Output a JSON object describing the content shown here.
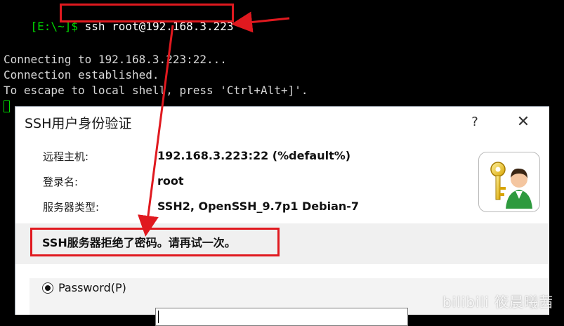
{
  "terminal": {
    "prompt": "[E:\\~]$",
    "command": "ssh root@192.168.3.223",
    "output": [
      "Connecting to 192.168.3.223:22...",
      "Connection established.",
      "To escape to local shell, press 'Ctrl+Alt+]'."
    ]
  },
  "dialog": {
    "title": "SSH用户身份验证",
    "help": "?",
    "close": "✕",
    "fields": [
      {
        "label": "远程主机:",
        "value": "192.168.3.223:22 (%default%)"
      },
      {
        "label": "登录名:",
        "value": "root"
      },
      {
        "label": "服务器类型:",
        "value": "SSH2, OpenSSH_9.7p1 Debian-7"
      }
    ],
    "error": "SSH服务器拒绝了密码。请再试一次。",
    "auth_method": "Password(P)",
    "password_value": ""
  },
  "watermark": "bilibili 筱晨曦茜",
  "colors": {
    "highlight": "#e0191f",
    "prompt": "#00d800"
  }
}
